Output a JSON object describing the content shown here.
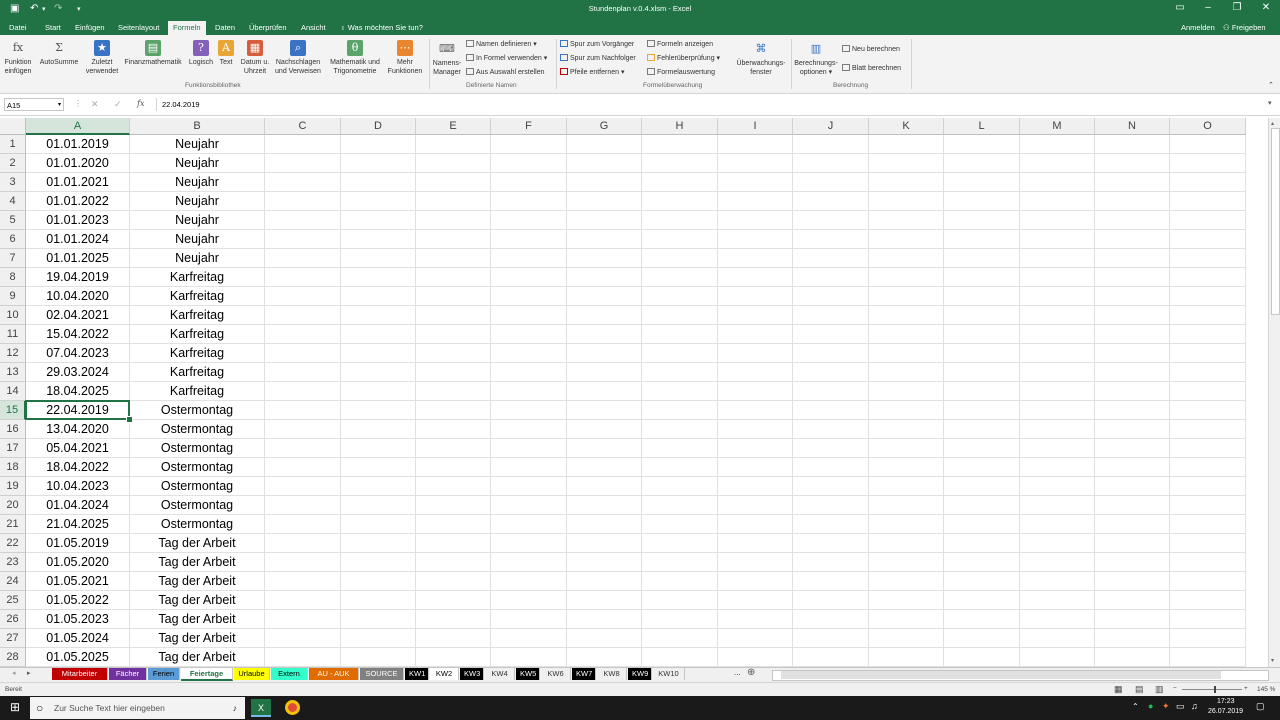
{
  "window": {
    "title": "Stundenplan v.0.4.xlsm - Excel",
    "undo_icon": "undo-icon",
    "redo_icon": "redo-icon"
  },
  "menu": {
    "tabs": [
      "Datei",
      "Start",
      "Einfügen",
      "Seitenlayout",
      "Formeln",
      "Daten",
      "Überprüfen",
      "Ansicht"
    ],
    "active_tab": "Formeln",
    "tell_me": "Was möchten Sie tun?",
    "signin": "Anmelden",
    "share": "Freigeben"
  },
  "ribbon": {
    "funktionsbibliothek": {
      "label": "Funktionsbibliothek",
      "buttons": [
        {
          "l1": "Funktion",
          "l2": "einfügen",
          "glyph": "fx",
          "color": "#f3f3f3"
        },
        {
          "l1": "AutoSumme",
          "l2": "",
          "glyph": "Σ",
          "color": "#f3f3f3"
        },
        {
          "l1": "Zuletzt",
          "l2": "verwendet",
          "glyph": "★",
          "color": "#3a73c4"
        },
        {
          "l1": "Finanzmathematik",
          "l2": "",
          "glyph": "▤",
          "color": "#5aa36b"
        },
        {
          "l1": "Logisch",
          "l2": "",
          "glyph": "?",
          "color": "#8460b8"
        },
        {
          "l1": "Text",
          "l2": "",
          "glyph": "A",
          "color": "#e8a637"
        },
        {
          "l1": "Datum u.",
          "l2": "Uhrzeit",
          "glyph": "▦",
          "color": "#d75d3c"
        },
        {
          "l1": "Nachschlagen",
          "l2": "und Verweisen",
          "glyph": "⌕",
          "color": "#3a73c4"
        },
        {
          "l1": "Mathematik und",
          "l2": "Trigonometrie",
          "glyph": "θ",
          "color": "#5aa36b"
        },
        {
          "l1": "Mehr",
          "l2": "Funktionen",
          "glyph": "⋯",
          "color": "#e8852e"
        }
      ]
    },
    "definierte_namen": {
      "label": "Definierte Namen",
      "manager_l1": "Namens-",
      "manager_l2": "Manager",
      "items": [
        "Namen definieren",
        "In Formel verwenden",
        "Aus Auswahl erstellen"
      ]
    },
    "formelueberwachung": {
      "label": "Formelüberwachung",
      "items": [
        "Spur zum Vorgänger",
        "Spur zum Nachfolger",
        "Pfeile entfernen",
        "Formeln anzeigen",
        "Fehlerüberprüfung",
        "Formelauswertung"
      ],
      "watch_l1": "Überwachungs-",
      "watch_l2": "fenster"
    },
    "berechnung": {
      "label": "Berechnung",
      "options_l1": "Berechnungs-",
      "options_l2": "optionen",
      "items": [
        "Neu berechnen",
        "Blatt berechnen"
      ]
    }
  },
  "formula_bar": {
    "name_box": "A15",
    "fx": "fx",
    "value": "22.04.2019"
  },
  "grid": {
    "columns": [
      "A",
      "B",
      "C",
      "D",
      "E",
      "F",
      "G",
      "H",
      "I",
      "J",
      "K",
      "L",
      "M",
      "N",
      "O"
    ],
    "selected_column": "A",
    "selected_row": 15,
    "rows": [
      [
        "01.01.2019",
        "Neujahr"
      ],
      [
        "01.01.2020",
        "Neujahr"
      ],
      [
        "01.01.2021",
        "Neujahr"
      ],
      [
        "01.01.2022",
        "Neujahr"
      ],
      [
        "01.01.2023",
        "Neujahr"
      ],
      [
        "01.01.2024",
        "Neujahr"
      ],
      [
        "01.01.2025",
        "Neujahr"
      ],
      [
        "19.04.2019",
        "Karfreitag"
      ],
      [
        "10.04.2020",
        "Karfreitag"
      ],
      [
        "02.04.2021",
        "Karfreitag"
      ],
      [
        "15.04.2022",
        "Karfreitag"
      ],
      [
        "07.04.2023",
        "Karfreitag"
      ],
      [
        "29.03.2024",
        "Karfreitag"
      ],
      [
        "18.04.2025",
        "Karfreitag"
      ],
      [
        "22.04.2019",
        "Ostermontag"
      ],
      [
        "13.04.2020",
        "Ostermontag"
      ],
      [
        "05.04.2021",
        "Ostermontag"
      ],
      [
        "18.04.2022",
        "Ostermontag"
      ],
      [
        "10.04.2023",
        "Ostermontag"
      ],
      [
        "01.04.2024",
        "Ostermontag"
      ],
      [
        "21.04.2025",
        "Ostermontag"
      ],
      [
        "01.05.2019",
        "Tag der Arbeit"
      ],
      [
        "01.05.2020",
        "Tag der Arbeit"
      ],
      [
        "01.05.2021",
        "Tag der Arbeit"
      ],
      [
        "01.05.2022",
        "Tag der Arbeit"
      ],
      [
        "01.05.2023",
        "Tag der Arbeit"
      ],
      [
        "01.05.2024",
        "Tag der Arbeit"
      ],
      [
        "01.05.2025",
        "Tag der Arbeit"
      ]
    ]
  },
  "sheets": [
    {
      "name": "Mitarbeiter",
      "bg": "#c00000",
      "fg": "#ffffff"
    },
    {
      "name": "Fächer",
      "bg": "#7030a0",
      "fg": "#ffffff"
    },
    {
      "name": "Ferien",
      "bg": "#5b9bd5",
      "fg": "#000000"
    },
    {
      "name": "Feiertage",
      "bg": "#ffffff",
      "fg": "#217346",
      "active": true
    },
    {
      "name": "Urlaube",
      "bg": "#ffff00",
      "fg": "#000000"
    },
    {
      "name": "Extern",
      "bg": "#33ffcc",
      "fg": "#000000"
    },
    {
      "name": "AU - AUK",
      "bg": "#e06c00",
      "fg": "#ffffff"
    },
    {
      "name": "SOURCE",
      "bg": "#808080",
      "fg": "#ffffff"
    },
    {
      "name": "KW1",
      "bg": "#000000",
      "fg": "#ffffff"
    },
    {
      "name": "KW2",
      "bg": "#ffffff",
      "fg": "#000000"
    },
    {
      "name": "KW3",
      "bg": "#000000",
      "fg": "#ffffff"
    },
    {
      "name": "KW4",
      "bg": "#f0f0f0",
      "fg": "#333333"
    },
    {
      "name": "KW5",
      "bg": "#000000",
      "fg": "#ffffff"
    },
    {
      "name": "KW6",
      "bg": "#f0f0f0",
      "fg": "#333333"
    },
    {
      "name": "KW7",
      "bg": "#000000",
      "fg": "#ffffff"
    },
    {
      "name": "KW8",
      "bg": "#f0f0f0",
      "fg": "#333333"
    },
    {
      "name": "KW9",
      "bg": "#000000",
      "fg": "#ffffff"
    },
    {
      "name": "KW10",
      "bg": "#f0f0f0",
      "fg": "#333333"
    }
  ],
  "sheet_more": "...",
  "status": {
    "ready": "Bereit",
    "zoom": "145 %"
  },
  "taskbar": {
    "search_placeholder": "Zur Suche Text hier eingeben",
    "time": "17:23",
    "date": "26.07.2019"
  },
  "colors": {
    "accent": "#217346",
    "selection_header": "#d6e5dc"
  }
}
